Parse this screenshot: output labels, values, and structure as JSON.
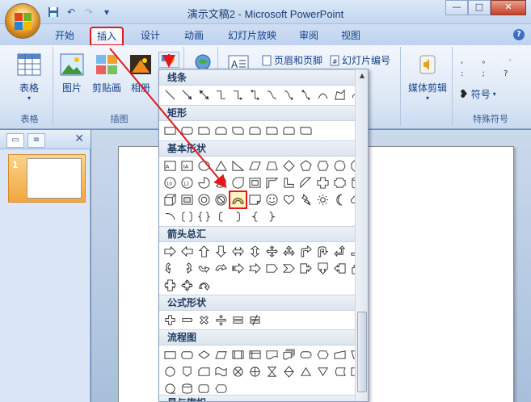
{
  "window": {
    "title": "演示文稿2 - Microsoft PowerPoint",
    "controls": [
      "—",
      "□",
      "✕"
    ]
  },
  "qat": {
    "save": "💾",
    "undo": "↶",
    "redo": "↷",
    "more": "▾"
  },
  "tabs": [
    {
      "label": "开始"
    },
    {
      "label": "插入"
    },
    {
      "label": "设计"
    },
    {
      "label": "动画"
    },
    {
      "label": "幻灯片放映"
    },
    {
      "label": "审阅"
    },
    {
      "label": "视图"
    }
  ],
  "active_tab": "插入",
  "help": "?",
  "ribbon": {
    "groups": {
      "tables": {
        "label": "表格",
        "table_button": "表格"
      },
      "illustrations": {
        "label": "插图",
        "picture": "图片",
        "clipart": "剪贴画",
        "album": "相册"
      },
      "text": {
        "header_footer": "页眉和页脚",
        "slide_number": "幻灯片编号"
      },
      "media": {
        "media_clip": "媒体剪辑"
      },
      "symbols": {
        "label": "特殊符号",
        "symbol": "符号"
      }
    }
  },
  "dropdown": {
    "sections": {
      "lines": "线条",
      "rect": "矩形",
      "basic": "基本形状",
      "arrows": "箭头总汇",
      "equation": "公式形状",
      "flowchart": "流程图",
      "stars": "星与旗帜"
    }
  },
  "slides_panel": {
    "slide_number": "1"
  },
  "colors": {
    "accent_red": "#e2191a",
    "ribbon_blue": "#15428b"
  }
}
